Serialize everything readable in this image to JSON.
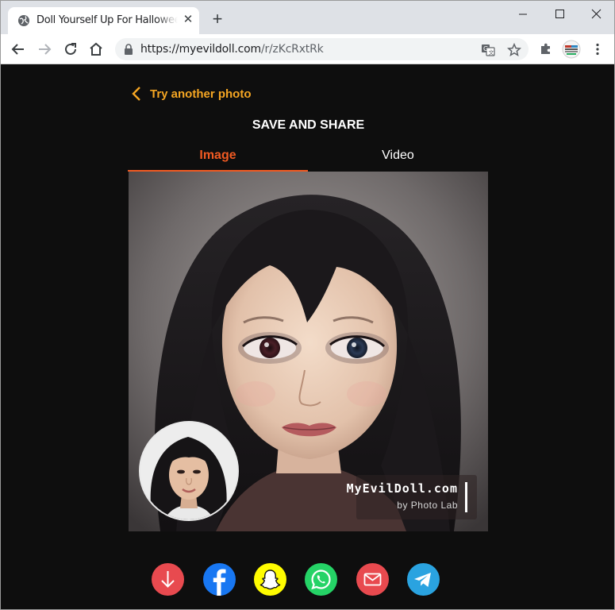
{
  "browser": {
    "tab_title": "Doll Yourself Up For Halloween",
    "new_tab_symbol": "+",
    "close_tab_symbol": "✕",
    "url_host": "https://myevildoll.com",
    "url_path": "/r/zKcRxtRk"
  },
  "page": {
    "back_label": "Try another photo",
    "section_title": "SAVE AND SHARE",
    "tabs": [
      {
        "label": "Image",
        "active": true
      },
      {
        "label": "Video",
        "active": false
      }
    ],
    "watermark": {
      "brand": "MyEvilDoll.com",
      "subtitle": "by Photo Lab"
    },
    "share_buttons": [
      {
        "name": "download",
        "color": "#e84a4f"
      },
      {
        "name": "facebook",
        "color": "#1877f2"
      },
      {
        "name": "snapchat",
        "color": "#fffc00"
      },
      {
        "name": "whatsapp",
        "color": "#25d366"
      },
      {
        "name": "email",
        "color": "#e84a4f"
      },
      {
        "name": "telegram",
        "color": "#2aa3e0"
      }
    ]
  },
  "colors": {
    "accent_orange": "#f05a22",
    "back_link": "#f5a623",
    "background": "#0e0e0e"
  }
}
